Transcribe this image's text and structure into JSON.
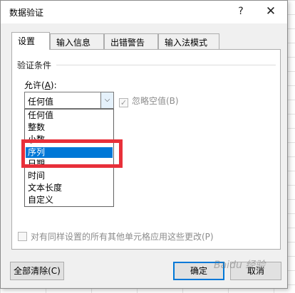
{
  "window": {
    "title": "数据验证",
    "help_label": "?",
    "close_label": "✕"
  },
  "tabs": [
    {
      "label": "设置",
      "active": true
    },
    {
      "label": "输入信息",
      "active": false
    },
    {
      "label": "出错警告",
      "active": false
    },
    {
      "label": "输入法模式",
      "active": false
    }
  ],
  "settings": {
    "group_label": "验证条件",
    "allow_label_prefix": "允许(",
    "allow_label_key": "A",
    "allow_label_suffix": "):",
    "allow_value": "任何值",
    "ignore_blank_label": "忽略空值(B)",
    "ignore_blank_checked": true,
    "apply_all_label": "对有同样设置的所有其他单元格应用这些更改(P)",
    "apply_all_checked": false
  },
  "dropdown": {
    "options": [
      "任何值",
      "整数",
      "小数",
      "序列",
      "日期",
      "时间",
      "文本长度",
      "自定义"
    ],
    "selected": "序列"
  },
  "buttons": {
    "clear_all": "全部清除(C)",
    "ok": "确定",
    "cancel": "取消"
  },
  "watermark": "Baidu 经验",
  "colors": {
    "highlight": "#0078d7",
    "annotation_red": "#e8303a"
  }
}
